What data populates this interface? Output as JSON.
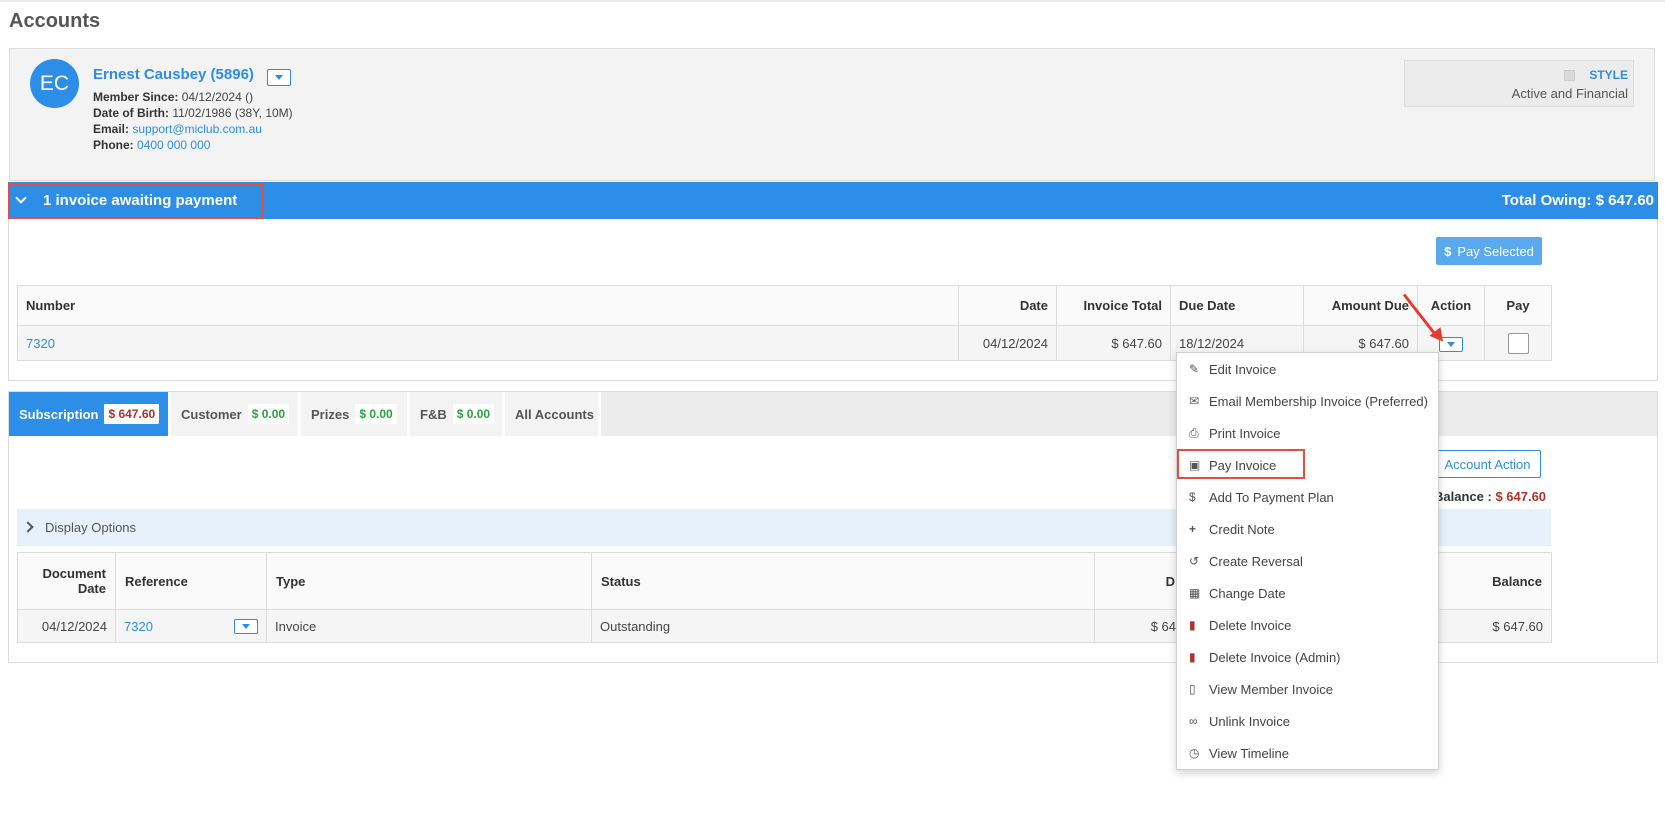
{
  "page": {
    "title": "Accounts"
  },
  "member": {
    "initials": "EC",
    "name": "Ernest Causbey (5896)",
    "member_since_label": "Member Since:",
    "member_since_value": "04/12/2024 ()",
    "dob_label": "Date of Birth:",
    "dob_value": "11/02/1986 (38Y, 10M)",
    "email_label": "Email:",
    "email_value": "support@miclub.com.au",
    "phone_label": "Phone:",
    "phone_value": "0400 000 000",
    "style_label": "STYLE",
    "status": "Active and Financial"
  },
  "invoice_bar": {
    "title": "1 invoice awaiting payment",
    "total_owing": "Total Owing: $ 647.60",
    "pay_selected_label": "Pay Selected",
    "pay_selected_icon": "$"
  },
  "invoice_table": {
    "headers": [
      "Number",
      "Date",
      "Invoice Total",
      "Due Date",
      "Amount Due",
      "Action",
      "Pay"
    ],
    "rows": [
      {
        "number": "7320",
        "date": "04/12/2024",
        "invoice_total": "$ 647.60",
        "due_date": "18/12/2024",
        "amount_due": "$ 647.60"
      }
    ]
  },
  "tabs": [
    {
      "label": "Subscription",
      "badge": "$ 647.60"
    },
    {
      "label": "Customer",
      "badge": "$ 0.00"
    },
    {
      "label": "Prizes",
      "badge": "$ 0.00"
    },
    {
      "label": "F&B",
      "badge": "$ 0.00"
    },
    {
      "label": "All Accounts"
    }
  ],
  "account_action_label": "Account Action",
  "balance": {
    "label": "Balance :",
    "value": "$ 647.60"
  },
  "display_options_label": "Display Options",
  "doc_table": {
    "headers": [
      "Document Date",
      "Reference",
      "Type",
      "Status",
      "Balance"
    ],
    "partial_header": "D",
    "rows": [
      {
        "document_date": "04/12/2024",
        "reference": "7320",
        "type": "Invoice",
        "status": "Outstanding",
        "partial": "$ 64",
        "balance": "$ 647.60"
      }
    ]
  },
  "menu": {
    "items": [
      {
        "label": "Edit Invoice",
        "icon": "pencil-icon"
      },
      {
        "label": "Email Membership Invoice (Preferred)",
        "icon": "envelope-icon"
      },
      {
        "label": "Print Invoice",
        "icon": "print-icon"
      },
      {
        "label": "Pay Invoice",
        "icon": "money-icon"
      },
      {
        "label": "Add To Payment Plan",
        "icon": "dollar-icon"
      },
      {
        "label": "Credit Note",
        "icon": "plus-icon"
      },
      {
        "label": "Create Reversal",
        "icon": "undo-icon"
      },
      {
        "label": "Change Date",
        "icon": "calendar-icon"
      },
      {
        "label": "Delete Invoice",
        "icon": "trash-icon"
      },
      {
        "label": "Delete Invoice (Admin)",
        "icon": "trash-icon"
      },
      {
        "label": "View Member Invoice",
        "icon": "file-icon"
      },
      {
        "label": "Unlink Invoice",
        "icon": "unlink-icon"
      },
      {
        "label": "View Timeline",
        "icon": "clock-icon"
      }
    ]
  },
  "colors": {
    "primary": "#2c8ee6",
    "amount_red": "#b0332a",
    "amount_green": "#27a33b",
    "highlight_red": "#e74c3c"
  }
}
